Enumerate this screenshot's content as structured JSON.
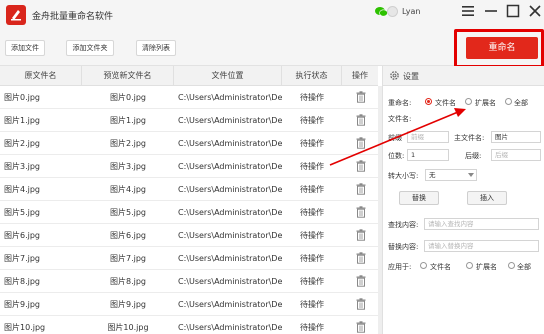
{
  "app": {
    "title": "金舟批量重命名软件",
    "user": "Lyan"
  },
  "toolbar": {
    "add_file": "添加文件",
    "add_folder": "添加文件夹",
    "clear_list": "清除列表",
    "rename": "重命名"
  },
  "table": {
    "headers": [
      "原文件名",
      "预览新文件名",
      "文件位置",
      "执行状态",
      "操作"
    ],
    "rows": [
      {
        "original": "图片0.jpg",
        "preview": "图片0.jpg",
        "location": "C:\\Users\\Administrator\\De...",
        "status": "待操作"
      },
      {
        "original": "图片1.jpg",
        "preview": "图片1.jpg",
        "location": "C:\\Users\\Administrator\\De...",
        "status": "待操作"
      },
      {
        "original": "图片2.jpg",
        "preview": "图片2.jpg",
        "location": "C:\\Users\\Administrator\\De...",
        "status": "待操作"
      },
      {
        "original": "图片3.jpg",
        "preview": "图片3.jpg",
        "location": "C:\\Users\\Administrator\\De...",
        "status": "待操作"
      },
      {
        "original": "图片4.jpg",
        "preview": "图片4.jpg",
        "location": "C:\\Users\\Administrator\\De...",
        "status": "待操作"
      },
      {
        "original": "图片5.jpg",
        "preview": "图片5.jpg",
        "location": "C:\\Users\\Administrator\\De...",
        "status": "待操作"
      },
      {
        "original": "图片6.jpg",
        "preview": "图片6.jpg",
        "location": "C:\\Users\\Administrator\\De...",
        "status": "待操作"
      },
      {
        "original": "图片7.jpg",
        "preview": "图片7.jpg",
        "location": "C:\\Users\\Administrator\\De...",
        "status": "待操作"
      },
      {
        "original": "图片8.jpg",
        "preview": "图片8.jpg",
        "location": "C:\\Users\\Administrator\\De...",
        "status": "待操作"
      },
      {
        "original": "图片9.jpg",
        "preview": "图片9.jpg",
        "location": "C:\\Users\\Administrator\\De...",
        "status": "待操作"
      },
      {
        "original": "图片10.jpg",
        "preview": "图片10.jpg",
        "location": "C:\\Users\\Administrator\\De...",
        "status": "待操作"
      }
    ]
  },
  "settings": {
    "title": "设置",
    "rename_label": "重命名:",
    "rename_options": [
      "文件名",
      "扩展名",
      "全部"
    ],
    "rename_selected": "文件名",
    "filename_label": "文件名:",
    "prefix_label": "前缀",
    "prefix_placeholder": "前缀",
    "main_label": "主文件名:",
    "main_value": "图片",
    "digits_label": "位数:",
    "digits_value": "1",
    "suffix_label": "后缀:",
    "suffix_placeholder": "后缀",
    "case_label": "转大小写:",
    "case_value": "无",
    "replace_button": "替换",
    "insert_button": "插入",
    "find_label": "查找内容:",
    "find_placeholder": "请输入查找内容",
    "replace_label": "替换内容:",
    "replace_placeholder": "请输入替换内容",
    "apply_label": "应用于:",
    "apply_options": [
      "文件名",
      "扩展名",
      "全部"
    ]
  },
  "colors": {
    "accent": "#e2281b",
    "highlight": "#e30000",
    "header_bg": "#f2f2f2"
  }
}
